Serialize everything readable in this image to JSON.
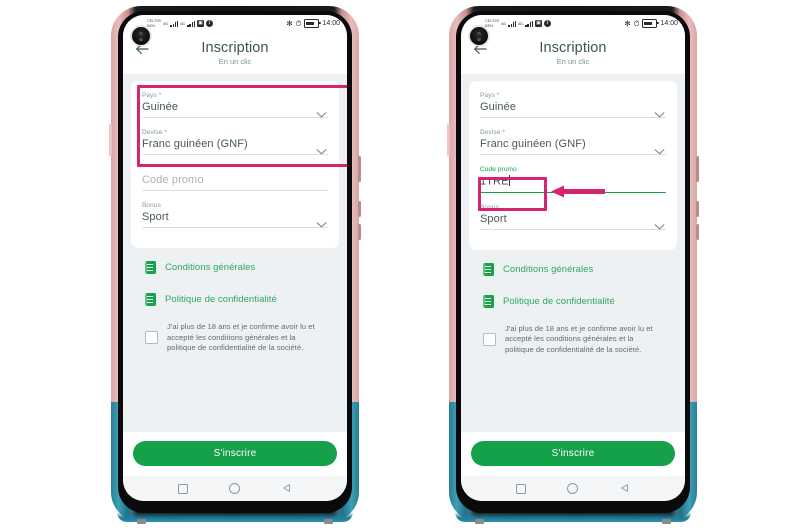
{
  "meta": {
    "page_background": "#ffffff",
    "accent_green": "#15a04a",
    "accent_pink": "#d6256e",
    "screen_background": "#eef1f4"
  },
  "status_bar": {
    "carrier_line1": "CELTIIS",
    "carrier_line2": "BEN",
    "network_label": "4G",
    "clock": "14:00",
    "icons": [
      "signal-icon",
      "signal-icon",
      "vibrate-icon",
      "facebook-icon",
      "bluetooth-icon",
      "alarm-icon",
      "battery-icon"
    ]
  },
  "header": {
    "title": "Inscription",
    "subtitle": "En un clic",
    "back_label": "back-arrow"
  },
  "phones": [
    {
      "id": "phone-left",
      "form": {
        "fields": [
          {
            "label": "Pays *",
            "value": "Guinée",
            "placeholder": "",
            "type": "select",
            "state": "default"
          },
          {
            "label": "Devise *",
            "value": "Franc guinéen (GNF)",
            "placeholder": "",
            "type": "select",
            "state": "default"
          },
          {
            "label": "",
            "value": "",
            "placeholder": "Code promo",
            "type": "text",
            "state": "empty"
          },
          {
            "label": "Bonus",
            "value": "Sport",
            "placeholder": "",
            "type": "select",
            "state": "default"
          }
        ]
      },
      "annotation": {
        "type": "highlight-box",
        "target": "pays-and-devise-fields",
        "color": "#d6256e"
      }
    },
    {
      "id": "phone-right",
      "form": {
        "fields": [
          {
            "label": "Pays *",
            "value": "Guinée",
            "placeholder": "",
            "type": "select",
            "state": "default"
          },
          {
            "label": "Devise *",
            "value": "Franc guinéen (GNF)",
            "placeholder": "",
            "type": "select",
            "state": "default"
          },
          {
            "label": "Code promo",
            "value": "1TRE",
            "placeholder": "",
            "type": "text",
            "state": "focused"
          },
          {
            "label": "Bonus",
            "value": "Sport",
            "placeholder": "",
            "type": "select",
            "state": "default"
          }
        ]
      },
      "annotation": {
        "type": "highlight-box-and-arrow",
        "target": "code-promo-field",
        "color": "#d6256e"
      }
    }
  ],
  "links": [
    {
      "label": "Conditions générales",
      "icon": "document-icon"
    },
    {
      "label": "Politique de confidentialité",
      "icon": "document-icon"
    }
  ],
  "consent": {
    "checked": false,
    "text": "J'ai plus de 18 ans et je confirme avoir lu et accepté les conditions générales et la politique de confidentialité de la société."
  },
  "footer": {
    "submit_label": "S'inscrire"
  },
  "navbar": {
    "items": [
      "recents-square-icon",
      "home-circle-icon",
      "back-triangle-icon"
    ]
  }
}
